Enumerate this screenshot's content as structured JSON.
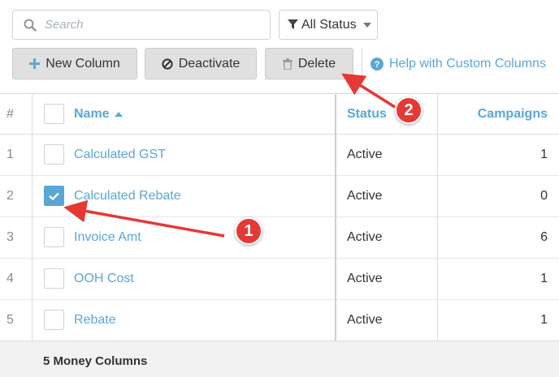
{
  "toolbar": {
    "search_placeholder": "Search",
    "status_filter": "All Status",
    "new_column": "New Column",
    "deactivate": "Deactivate",
    "delete": "Delete",
    "help": "Help with Custom Columns"
  },
  "table": {
    "headers": {
      "num": "#",
      "name": "Name",
      "status": "Status",
      "campaigns": "Campaigns"
    },
    "rows": [
      {
        "num": "1",
        "name": "Calculated GST",
        "status": "Active",
        "campaigns": "1",
        "checked": false
      },
      {
        "num": "2",
        "name": "Calculated Rebate",
        "status": "Active",
        "campaigns": "0",
        "checked": true
      },
      {
        "num": "3",
        "name": "Invoice Amt",
        "status": "Active",
        "campaigns": "6",
        "checked": false
      },
      {
        "num": "4",
        "name": "OOH Cost",
        "status": "Active",
        "campaigns": "1",
        "checked": false
      },
      {
        "num": "5",
        "name": "Rebate",
        "status": "Active",
        "campaigns": "1",
        "checked": false
      }
    ],
    "footer": "5 Money Columns"
  },
  "annotations": {
    "step1": "1",
    "step2": "2"
  },
  "colors": {
    "accent": "#5aa7d6",
    "annotation": "#e53935"
  }
}
